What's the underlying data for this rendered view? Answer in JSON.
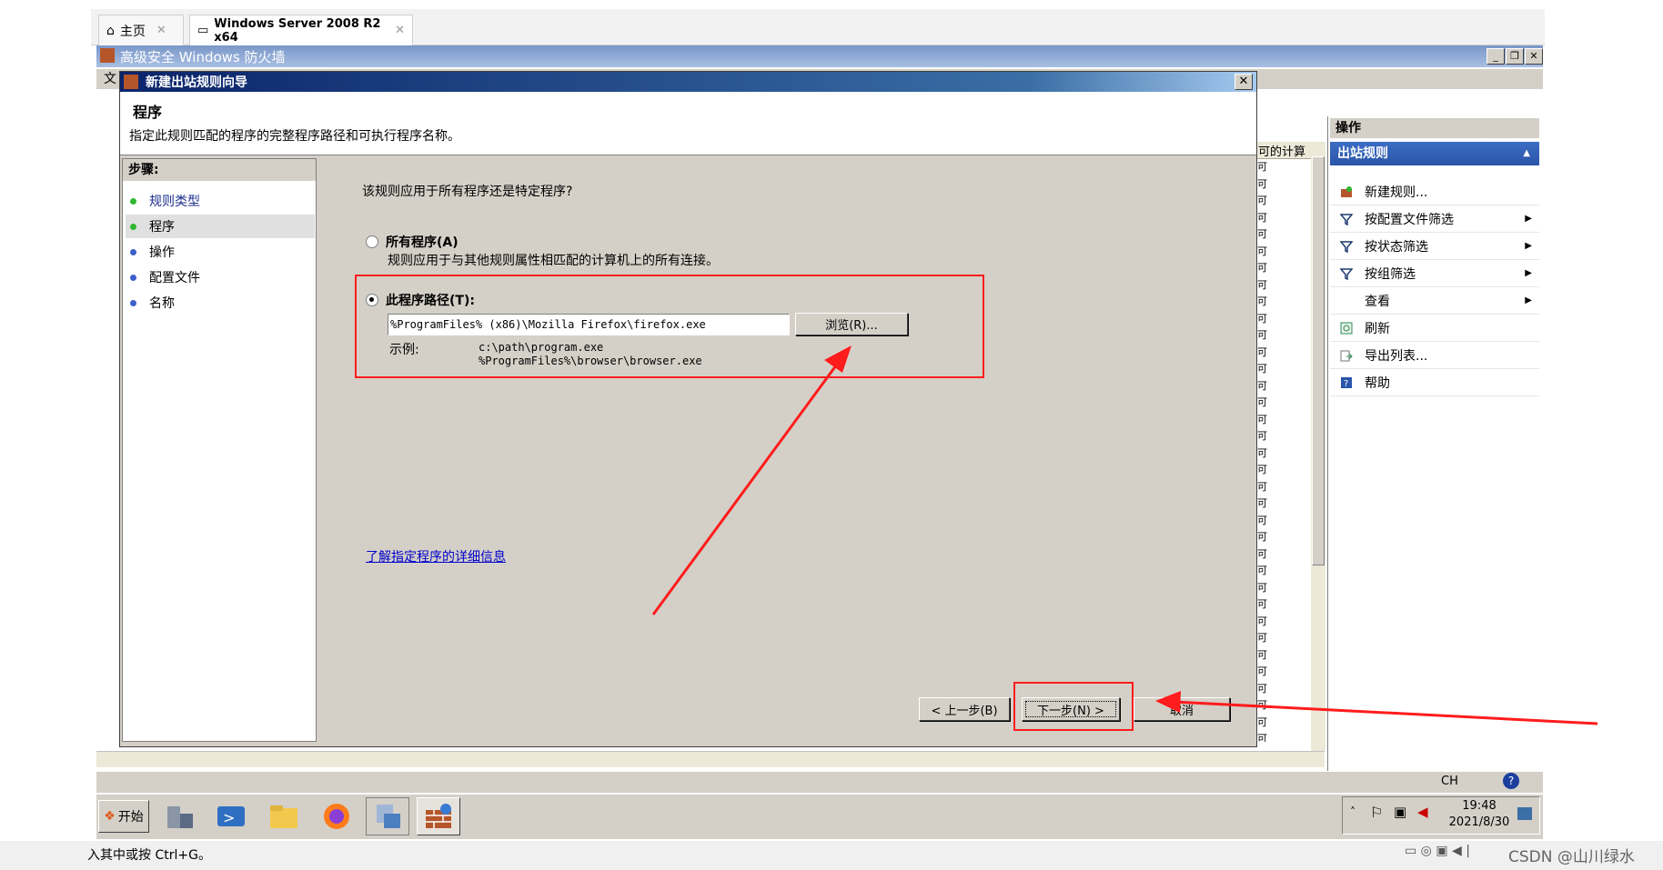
{
  "host": {
    "tabs": [
      {
        "label": "主页"
      },
      {
        "label": "Windows Server 2008 R2 x64"
      }
    ],
    "bottom_hint": "入其中或按 Ctrl+G。",
    "watermark": "CSDN @山川绿水"
  },
  "firewall_window": {
    "title": "高级安全 Windows 防火墙",
    "menu_letter": "文",
    "column_header": "可的计算",
    "column_cells": [
      "可",
      "可",
      "可",
      "可",
      "可",
      "可",
      "可",
      "可",
      "可",
      "可",
      "可",
      "可",
      "可",
      "可",
      "可",
      "可",
      "可",
      "可",
      "可",
      "可",
      "可",
      "可",
      "可",
      "可",
      "可",
      "可",
      "可",
      "可",
      "可",
      "可",
      "可",
      "可",
      "可",
      "可",
      "可"
    ],
    "actions": {
      "header": "操作",
      "section": "出站规则",
      "items": [
        {
          "label": "新建规则...",
          "icon": "new-rule-icon",
          "submenu": false
        },
        {
          "label": "按配置文件筛选",
          "icon": "filter-icon",
          "submenu": true
        },
        {
          "label": "按状态筛选",
          "icon": "filter-icon",
          "submenu": true
        },
        {
          "label": "按组筛选",
          "icon": "filter-icon",
          "submenu": true
        },
        {
          "label": "查看",
          "icon": "",
          "submenu": true
        },
        {
          "label": "刷新",
          "icon": "refresh-icon",
          "submenu": false
        },
        {
          "label": "导出列表...",
          "icon": "export-icon",
          "submenu": false
        },
        {
          "label": "帮助",
          "icon": "help-icon",
          "submenu": false
        }
      ]
    },
    "status_lang": "CH"
  },
  "wizard": {
    "title": "新建出站规则向导",
    "page_title": "程序",
    "page_desc": "指定此规则匹配的程序的完整程序路径和可执行程序名称。",
    "steps_header": "步骤:",
    "steps": [
      {
        "label": "规则类型",
        "state": "done",
        "color": "#2eb82e"
      },
      {
        "label": "程序",
        "state": "current",
        "color": "#2eb82e"
      },
      {
        "label": "操作",
        "state": "pending",
        "color": "#3b5fc9"
      },
      {
        "label": "配置文件",
        "state": "pending",
        "color": "#3b5fc9"
      },
      {
        "label": "名称",
        "state": "pending",
        "color": "#3b5fc9"
      }
    ],
    "question": "该规则应用于所有程序还是特定程序?",
    "option_all": {
      "label": "所有程序(A)",
      "desc": "规则应用于与其他规则属性相匹配的计算机上的所有连接。",
      "selected": false
    },
    "option_path": {
      "label": "此程序路径(T):",
      "selected": true
    },
    "path_value": "%ProgramFiles% (x86)\\Mozilla Firefox\\firefox.exe",
    "browse_label": "浏览(R)...",
    "example_label": "示例:",
    "example_1": "c:\\path\\program.exe",
    "example_2": "%ProgramFiles%\\browser\\browser.exe",
    "learn_more": "了解指定程序的详细信息",
    "back_label": "< 上一步(B)",
    "next_label": "下一步(N) >",
    "cancel_label": "取消"
  },
  "taskbar": {
    "start_label": "开始",
    "apps": [
      "server-manager-icon",
      "powershell-icon",
      "explorer-icon",
      "firefox-icon",
      "network-icon",
      "firewall-icon"
    ],
    "time": "19:48",
    "date": "2021/8/30"
  },
  "colors": {
    "annotation": "#ff1c1c",
    "titlebar": "#0a246a",
    "section": "#2a55a8"
  }
}
